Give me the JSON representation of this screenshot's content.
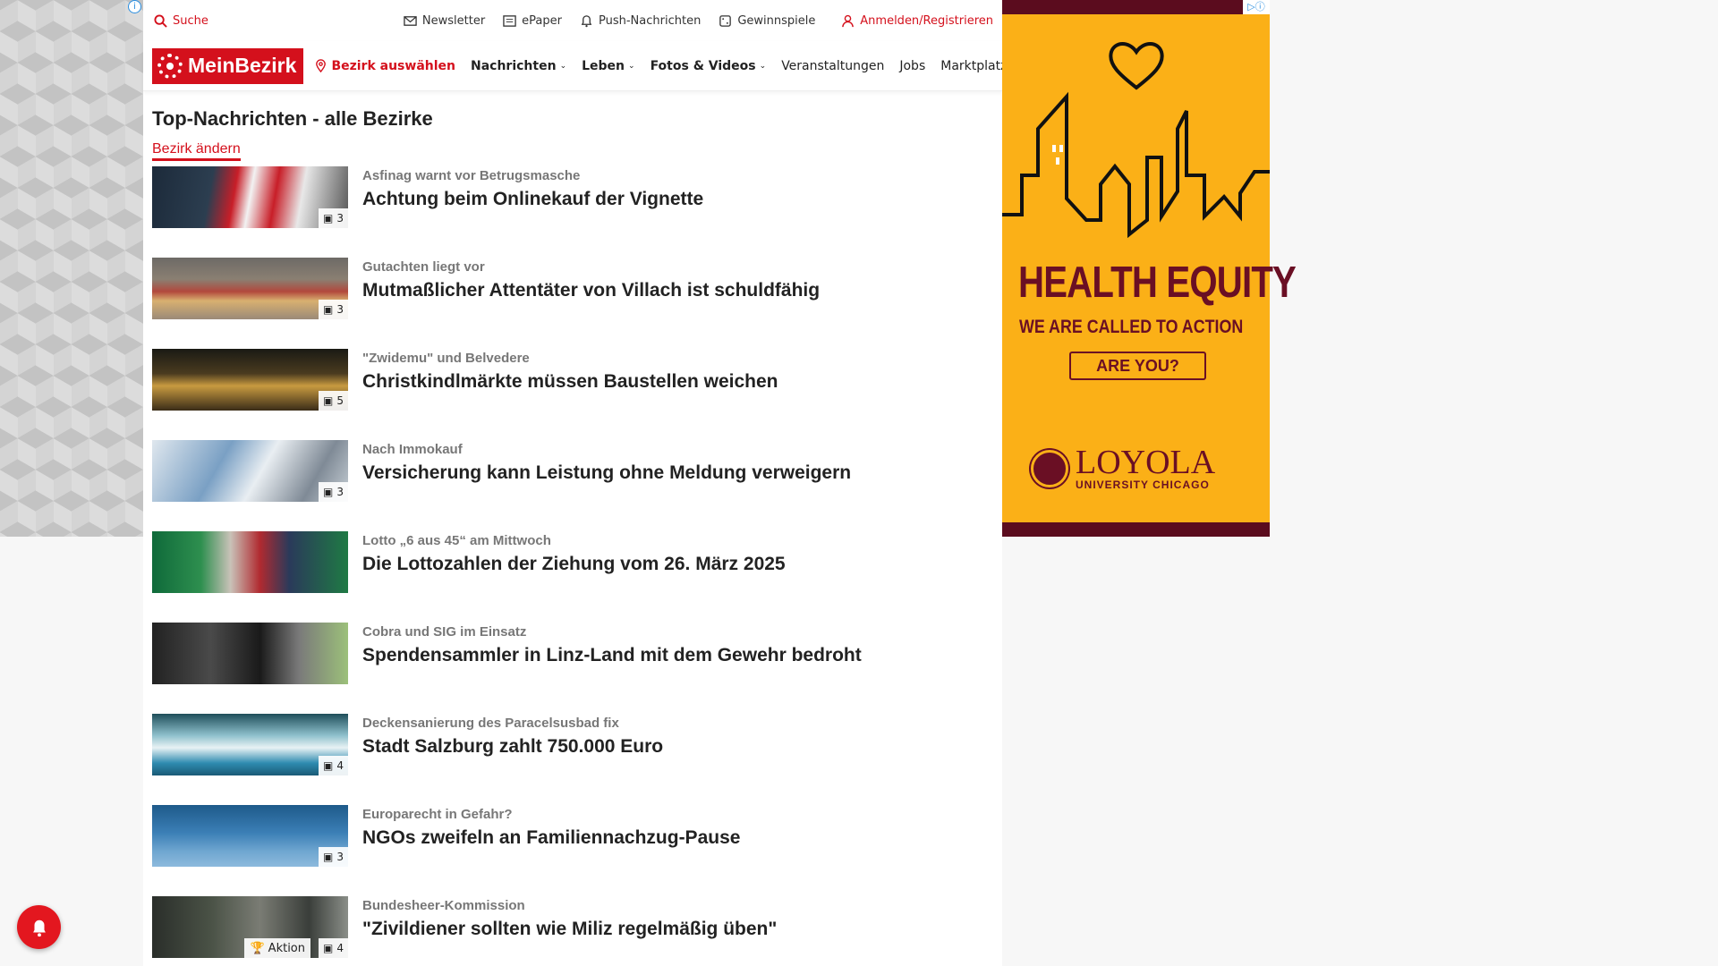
{
  "topbar": {
    "search_label": "Suche",
    "newsletter_label": "Newsletter",
    "epaper_label": "ePaper",
    "push_label": "Push-Nachrichten",
    "gewinnspiele_label": "Gewinnspiele",
    "login_label": "Anmelden/Registrieren"
  },
  "nav": {
    "logo_text": "MeinBezirk",
    "bezirk_label": "Bezirk auswählen",
    "items": [
      {
        "label": "Nachrichten"
      },
      {
        "label": "Leben"
      },
      {
        "label": "Fotos & Videos"
      },
      {
        "label": "Veranstaltungen"
      },
      {
        "label": "Jobs"
      },
      {
        "label": "Marktplatz"
      }
    ]
  },
  "content": {
    "title": "Top-Nachrichten - alle Bezirke",
    "change_label": "Bezirk ändern",
    "articles": [
      {
        "kicker": "Asfinag warnt vor Betrugsmasche",
        "headline": "Achtung beim Onlinekauf der Vignette",
        "count": "3"
      },
      {
        "kicker": "Gutachten liegt vor",
        "headline": "Mutmaßlicher Attentäter von Villach ist schuldfähig",
        "count": "3"
      },
      {
        "kicker": "\"Zwidemu\" und Belvedere",
        "headline": "Christkindlmärkte müssen Baustellen weichen",
        "count": "5"
      },
      {
        "kicker": "Nach Immokauf",
        "headline": "Versicherung kann Leistung ohne Meldung verweigern",
        "count": "3"
      },
      {
        "kicker": "Lotto „6 aus 45“ am Mittwoch",
        "headline": "Die Lottozahlen der Ziehung vom 26. März 2025",
        "count": ""
      },
      {
        "kicker": "Cobra und SIG im Einsatz",
        "headline": "Spendensammler in Linz-Land mit dem Gewehr bedroht",
        "count": ""
      },
      {
        "kicker": "Deckensanierung des Paracelsusbad fix",
        "headline": "Stadt Salzburg zahlt 750.000 Euro",
        "count": "4"
      },
      {
        "kicker": "Europarecht in Gefahr?",
        "headline": "NGOs zweifeln an Familiennachzug-Pause",
        "count": "3"
      },
      {
        "kicker": "Bundesheer-Kommission",
        "headline": "\"Zivildiener sollten wie Miliz regelmäßig üben\"",
        "count": "4",
        "extra": "Aktion"
      }
    ]
  },
  "ad": {
    "headline": "HEALTH EQUITY",
    "subline": "WE ARE CALLED TO ACTION",
    "button": "ARE YOU?",
    "brand": "LOYOLA",
    "brand_sub": "UNIVERSITY CHICAGO"
  },
  "colors": {
    "accent": "#d4101c",
    "ad_bg": "#fbb017",
    "ad_dark": "#6a0f24"
  }
}
